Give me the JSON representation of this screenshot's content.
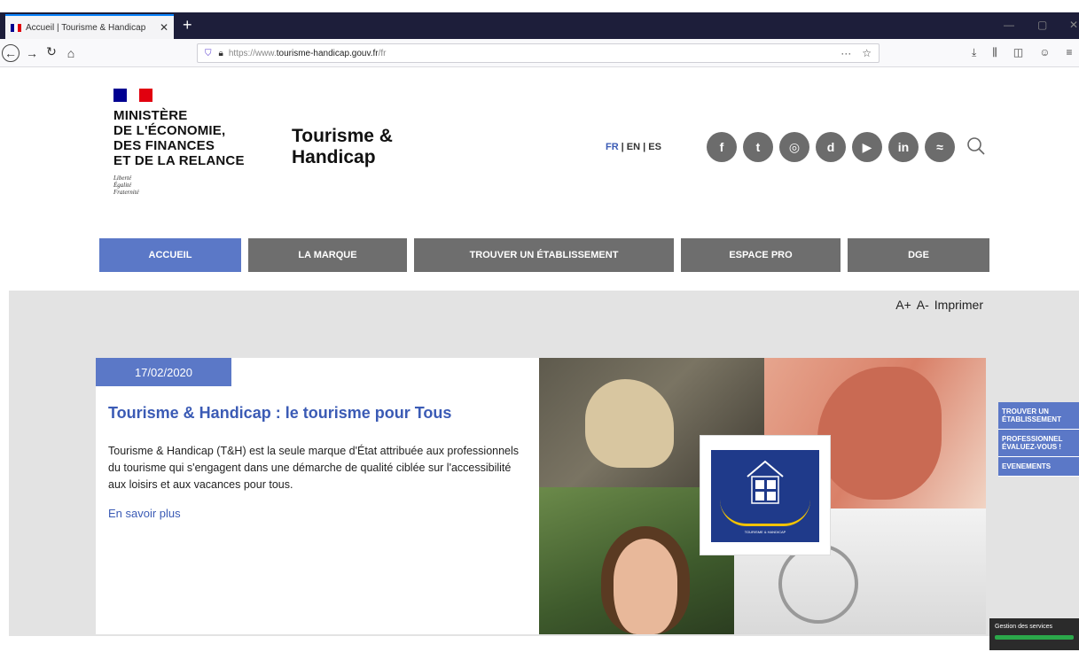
{
  "browser": {
    "tab_title": "Accueil | Tourisme & Handicap",
    "tab_close": "✕",
    "new_tab": "+",
    "url_prefix": "https://www.",
    "url_host": "tourisme-handicap.gouv.fr",
    "url_path": "/fr",
    "url_menu": "···",
    "url_star": "☆"
  },
  "header": {
    "ministry_lines": [
      "MINISTÈRE",
      "DE L'ÉCONOMIE,",
      "DES FINANCES",
      "ET DE LA RELANCE"
    ],
    "motto": [
      "Liberté",
      "Égalité",
      "Fraternité"
    ],
    "brand": [
      "Tourisme &",
      "Handicap"
    ],
    "langs": [
      "FR",
      "| EN",
      "| ES"
    ],
    "socials": [
      {
        "label": "f",
        "name": "facebook-icon"
      },
      {
        "label": "t",
        "name": "twitter-icon"
      },
      {
        "label": "◎",
        "name": "instagram-icon"
      },
      {
        "label": "d",
        "name": "dailymotion-icon"
      },
      {
        "label": "▶",
        "name": "youtube-icon"
      },
      {
        "label": "in",
        "name": "linkedin-icon"
      },
      {
        "label": "≈",
        "name": "rss-icon"
      }
    ]
  },
  "menu": [
    {
      "label": "ACCUEIL",
      "active": true
    },
    {
      "label": "LA MARQUE",
      "active": false
    },
    {
      "label": "TROUVER UN ÉTABLISSEMENT",
      "active": false
    },
    {
      "label": "ESPACE PRO",
      "active": false
    },
    {
      "label": "DGE",
      "active": false
    }
  ],
  "tools": {
    "font_plus": "A+",
    "font_minus": "A-",
    "print": "Imprimer"
  },
  "article": {
    "date": "17/02/2020",
    "title": "Tourisme & Handicap : le tourisme pour Tous",
    "text": "Tourisme & Handicap (T&H) est la seule marque d'État attribuée aux professionnels du tourisme qui s'engagent dans une démarche de qualité ciblée sur l'accessibilité aux loisirs et aux vacances pour tous.",
    "more": "En savoir plus",
    "logo_text": "TOURISME & HANDICAP"
  },
  "sidetabs": [
    "TROUVER UN\nÉTABLISSEMENT",
    "PROFESSIONNEL\nÉVALUEZ-VOUS !",
    "EVENEMENTS"
  ],
  "cookie": {
    "label": "Gestion des services"
  },
  "colors": {
    "accent": "#5b78c7",
    "menu": "#6e6e6e",
    "title": "#3b5bb5",
    "flag_blue": "#000091",
    "flag_red": "#e1000f"
  }
}
